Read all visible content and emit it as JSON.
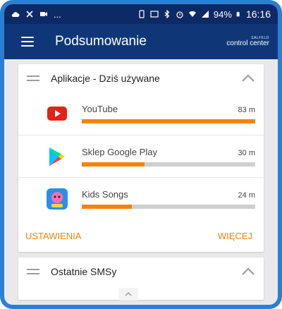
{
  "statusbar": {
    "left_extra": "...",
    "battery": "94%",
    "time": "16:16"
  },
  "appbar": {
    "title": "Podsumowanie",
    "brand_top": "SALFELD",
    "brand_main": "control center"
  },
  "apps_card": {
    "title": "Aplikacje - Dziś używane",
    "items": [
      {
        "name": "YouTube",
        "time": "83 m",
        "usage_fraction": 1.0
      },
      {
        "name": "Sklep Google Play",
        "time": "30 m",
        "usage_fraction": 0.36
      },
      {
        "name": "Kids Songs",
        "time": "24 m",
        "usage_fraction": 0.29
      }
    ],
    "settings_label": "USTAWIENIA",
    "more_label": "WIĘCEJ"
  },
  "sms_card": {
    "title": "Ostatnie SMSy"
  },
  "colors": {
    "accent": "#f5840c",
    "appbar": "#0f3778",
    "statusbar": "#0e2a66",
    "frame": "#2a7fd3"
  }
}
